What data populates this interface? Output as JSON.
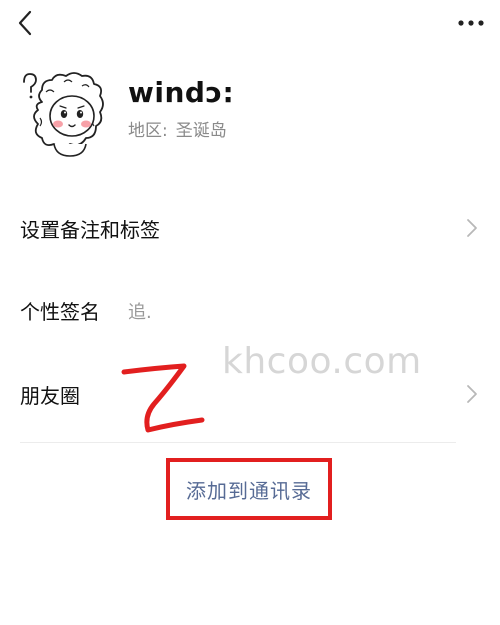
{
  "topbar": {
    "back_icon": "chevron-left-icon",
    "more_icon": "more-dots-icon"
  },
  "profile": {
    "avatar_icon": "cartoon-sheep-avatar",
    "nickname": "windɔ:",
    "region_label": "地区:",
    "region_value": "圣诞岛"
  },
  "rows": [
    {
      "label": "设置备注和标签",
      "value": "",
      "chevron": true
    },
    {
      "label": "个性签名",
      "value": "追.",
      "chevron": false
    },
    {
      "label": "朋友圈",
      "value": "",
      "chevron": true
    }
  ],
  "action": {
    "add_contact_label": "添加到通讯录"
  },
  "watermark": "khcoo.com",
  "colors": {
    "link": "#576b95",
    "annotation_red": "#e21f1f",
    "secondary_text": "#8a8a8a"
  }
}
